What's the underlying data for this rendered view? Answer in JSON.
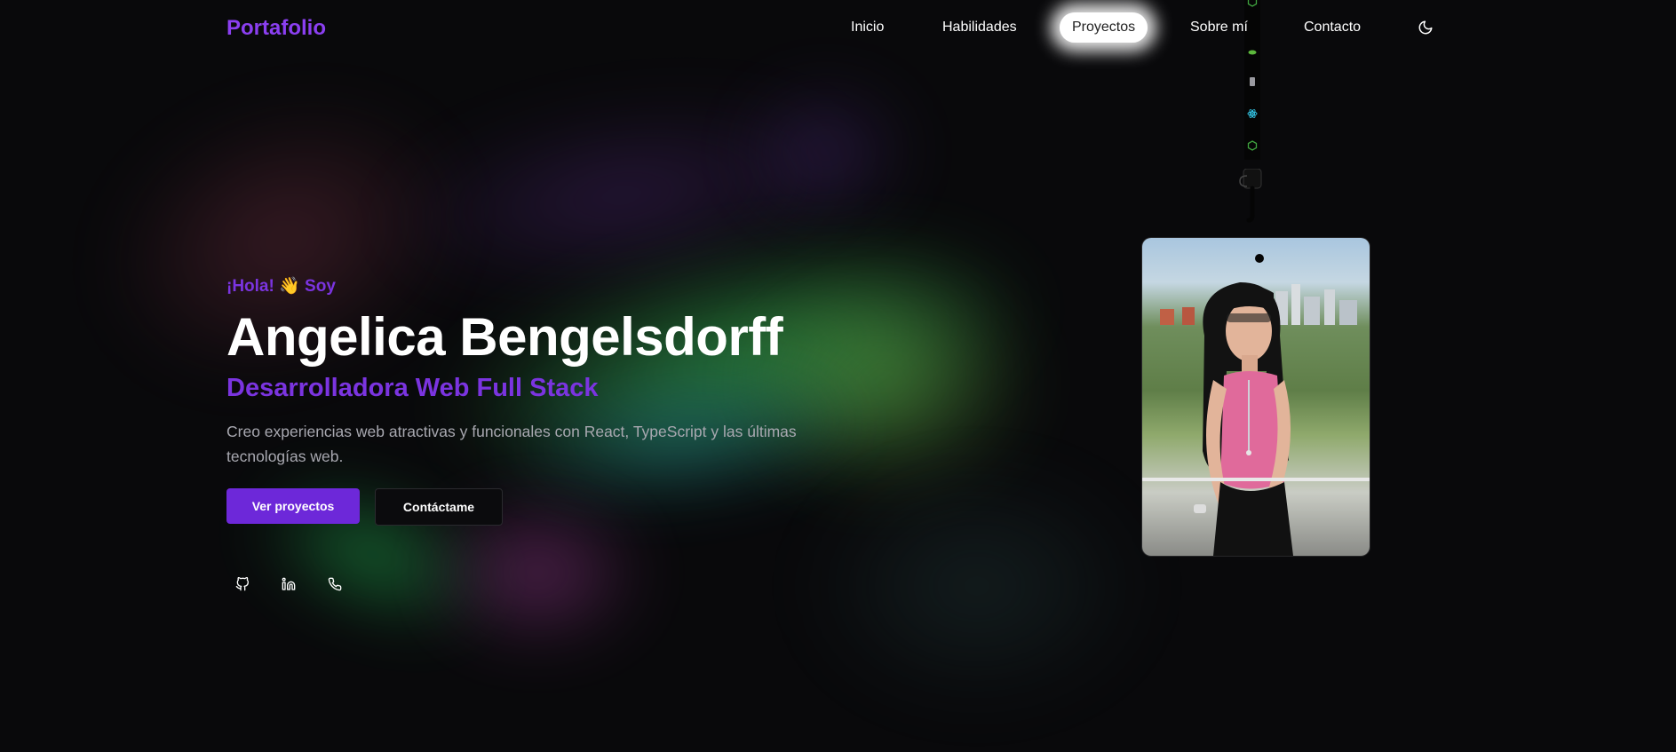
{
  "nav": {
    "logo": "Portafolio",
    "links": [
      "Inicio",
      "Habilidades",
      "Proyectos",
      "Sobre mí",
      "Contacto"
    ],
    "active_link": "Proyectos",
    "theme_toggle_icon": "moon-icon"
  },
  "hero": {
    "greeting": "¡Hola! 👋 Soy",
    "name": "Angelica Bengelsdorff",
    "role": "Desarrolladora Web Full Stack",
    "description": "Creo experiencias web atractivas y funcionales con React, TypeScript y las últimas tecnologías web.",
    "primary_button": "Ver proyectos",
    "secondary_button": "Contáctame"
  },
  "socials": {
    "icons": [
      "github-icon",
      "linkedin-icon",
      "phone-icon"
    ]
  },
  "badge": {
    "photo": "profile-photo",
    "lanyard_icons": [
      "node-icon",
      "leaf-icon",
      "file-icon",
      "react-icon",
      "node-icon"
    ]
  },
  "colors": {
    "accent": "#7b34e0",
    "primary_button": "#6d28d9",
    "background": "#09090b"
  }
}
